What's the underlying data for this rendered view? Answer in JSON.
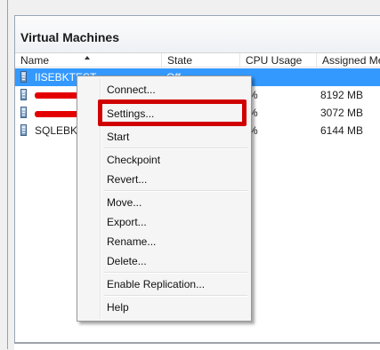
{
  "vm_panel": {
    "title": "Virtual Machines",
    "columns": [
      "Name",
      "State",
      "CPU Usage",
      "Assigned Me"
    ],
    "rows": [
      {
        "name": "IISEBKTEST",
        "state": "Off",
        "cpu": "",
        "memory": "",
        "selected": true,
        "redacted": false
      },
      {
        "name": "",
        "state": "",
        "cpu": "%",
        "memory": "8192 MB",
        "selected": false,
        "redacted": true
      },
      {
        "name": "",
        "state": "",
        "cpu": "%",
        "memory": "3072 MB",
        "selected": false,
        "redacted": true
      },
      {
        "name": "SQLEBKT",
        "state": "",
        "cpu": "%",
        "memory": "6144 MB",
        "selected": false,
        "redacted": false
      }
    ]
  },
  "context_menu": {
    "items": {
      "connect": "Connect...",
      "settings": "Settings...",
      "start": "Start",
      "checkpoint": "Checkpoint",
      "revert": "Revert...",
      "move": "Move...",
      "export": "Export...",
      "rename": "Rename...",
      "delete": "Delete...",
      "enable_replication": "Enable Replication...",
      "help": "Help"
    }
  },
  "colors": {
    "selection": "#3399ff",
    "highlight_box": "#d00000",
    "redaction": "#e40000"
  },
  "icons": {
    "vm_icon": "virtual-machine-icon",
    "sort_icon": "sort-ascending-icon"
  }
}
